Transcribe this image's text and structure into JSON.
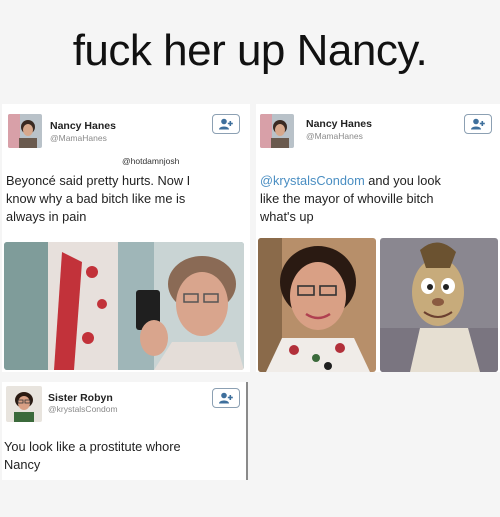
{
  "headline": "fuck her up Nancy.",
  "tweet_left": {
    "name": "Nancy Hanes",
    "handle": "@MamaHanes",
    "reply_to": "@hotdamnjosh",
    "text_lines": [
      "Beyoncé said pretty hurts. Now I",
      "know why a bad bitch like me is",
      "always in pain"
    ],
    "follow_icon": "follow-user-icon"
  },
  "tweet_right": {
    "name": "Nancy Hanes",
    "handle": "@MamaHanes",
    "text_lines": [
      "@krystalsCondom and you look",
      "like the mayor of whoville bitch",
      "what's up"
    ],
    "mention": "@krystalsCondom",
    "follow_icon": "follow-user-icon"
  },
  "tweet_bottom": {
    "name": "Sister Robyn",
    "handle": "@krystalsCondom",
    "text_lines": [
      "You look like a prostitute whore",
      "Nancy"
    ],
    "follow_icon": "follow-user-icon"
  },
  "colors": {
    "background": "#f5f5f5",
    "card": "#ffffff",
    "mention_blue": "#4a8ec2",
    "follow_border": "#8ca0b3"
  }
}
